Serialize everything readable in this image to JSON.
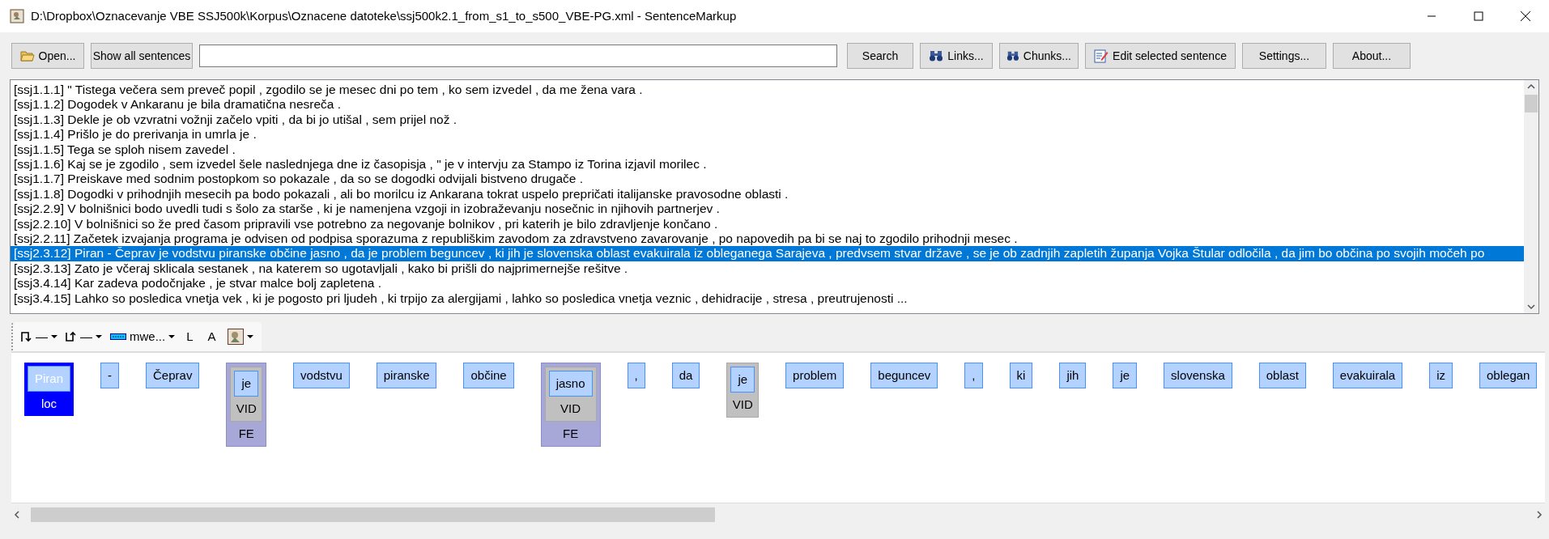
{
  "window": {
    "title": "D:\\Dropbox\\Oznacevanje VBE SSJ500k\\Korpus\\Oznacene datoteke\\ssj500k2.1_from_s1_to_s500_VBE-PG.xml - SentenceMarkup"
  },
  "toolbar": {
    "buttons": [
      {
        "label": "Open...",
        "kind": "open"
      },
      {
        "label": "Show all sentences",
        "kind": "plain"
      }
    ],
    "right_buttons": [
      {
        "label": "Search",
        "kind": "plain"
      },
      {
        "label": "Links...",
        "kind": "binoculars"
      },
      {
        "label": "Chunks...",
        "kind": "binoculars"
      },
      {
        "label": "Edit selected sentence",
        "kind": "edit"
      },
      {
        "label": "Settings...",
        "kind": "plain"
      },
      {
        "label": "About...",
        "kind": "plain"
      }
    ]
  },
  "sentences": [
    {
      "text": "[ssj1.1.1] \" Tistega večera sem preveč popil , zgodilo se je mesec dni po tem , ko sem izvedel , da me žena vara .",
      "selected": false
    },
    {
      "text": "[ssj1.1.2] Dogodek v Ankaranu je bila dramatična nesreča .",
      "selected": false
    },
    {
      "text": "[ssj1.1.3] Dekle je ob vzvratni vožnji začelo vpiti , da bi jo utišal , sem prijel nož .",
      "selected": false
    },
    {
      "text": "[ssj1.1.4] Prišlo je do prerivanja in umrla je .",
      "selected": false
    },
    {
      "text": "[ssj1.1.5] Tega se sploh nisem zavedel .",
      "selected": false
    },
    {
      "text": "[ssj1.1.6] Kaj se je zgodilo , sem izvedel šele naslednjega dne iz časopisja , \" je v intervju za Stampo iz Torina izjavil morilec .",
      "selected": false
    },
    {
      "text": "[ssj1.1.7] Preiskave med sodnim postopkom so pokazale , da so se dogodki odvijali bistveno drugače .",
      "selected": false
    },
    {
      "text": "[ssj1.1.8] Dogodki v prihodnjih mesecih pa bodo pokazali , ali bo morilcu iz Ankarana tokrat uspelo prepričati italijanske pravosodne oblasti .",
      "selected": false
    },
    {
      "text": "[ssj2.2.9] V bolnišnici bodo uvedli tudi s šolo za starše , ki je namenjena vzgoji in izobraževanju nosečnic in njihovih partnerjev .",
      "selected": false
    },
    {
      "text": "[ssj2.2.10] V bolnišnici so že pred časom pripravili vse potrebno za negovanje bolnikov , pri katerih je bilo zdravljenje končano .",
      "selected": false
    },
    {
      "text": "[ssj2.2.11] Začetek izvajanja programa je odvisen od podpisa sporazuma z republiškim zavodom za zdravstveno zavarovanje , po napovedih pa bi se naj to zgodilo prihodnji mesec .",
      "selected": false
    },
    {
      "text": "[ssj2.3.12] Piran - Čeprav je vodstvu piranske občine jasno , da je problem beguncev , ki jih je slovenska oblast evakuirala iz obleganega Sarajeva , predvsem stvar države , se je ob zadnjih zapletih županja Vojka Štular odločila , da jim bo občina po svojih močeh po",
      "selected": true
    },
    {
      "text": "[ssj2.3.13] Zato je včeraj sklicala sestanek , na katerem so ugotavljali , kako bi prišli do najprimernejše rešitve .",
      "selected": false
    },
    {
      "text": "[ssj3.4.14] Kar zadeva podočnjake , je stvar malce bolj zapletena .",
      "selected": false
    },
    {
      "text": "[ssj3.4.15] Lahko so posledica vnetja vek , ki je pogosto pri ljudeh , ki trpijo za alergijami , lahko so posledica vnetja veznic , dehidracije , stresa , preutrujenosti ...",
      "selected": false
    }
  ],
  "markup_toolbar": [
    {
      "kind": "arrow-down",
      "label": "—"
    },
    {
      "kind": "arrow-up",
      "label": "—"
    },
    {
      "kind": "mwe",
      "label": "mwe..."
    },
    {
      "kind": "text",
      "label": "L"
    },
    {
      "kind": "text",
      "label": "A"
    },
    {
      "kind": "picture-menu"
    }
  ],
  "tokens": [
    {
      "text": "Piran",
      "annotations": [
        {
          "label": "loc",
          "kind": "ne"
        }
      ]
    },
    {
      "text": "-"
    },
    {
      "text": "Čeprav"
    },
    {
      "text": "je",
      "annotations": [
        {
          "label": "VID",
          "kind": "vid"
        },
        {
          "label": "FE",
          "kind": "fe"
        }
      ]
    },
    {
      "text": "vodstvu"
    },
    {
      "text": "piranske"
    },
    {
      "text": "občine"
    },
    {
      "text": "jasno",
      "annotations": [
        {
          "label": "VID",
          "kind": "vid"
        },
        {
          "label": "FE",
          "kind": "fe"
        }
      ]
    },
    {
      "text": ","
    },
    {
      "text": "da"
    },
    {
      "text": "je",
      "annotations": [
        {
          "label": "VID",
          "kind": "vid"
        }
      ]
    },
    {
      "text": "problem"
    },
    {
      "text": "beguncev"
    },
    {
      "text": ","
    },
    {
      "text": "ki"
    },
    {
      "text": "jih"
    },
    {
      "text": "je"
    },
    {
      "text": "slovenska"
    },
    {
      "text": "oblast"
    },
    {
      "text": "evakuirala"
    },
    {
      "text": "iz"
    },
    {
      "text": "oblegan"
    }
  ]
}
